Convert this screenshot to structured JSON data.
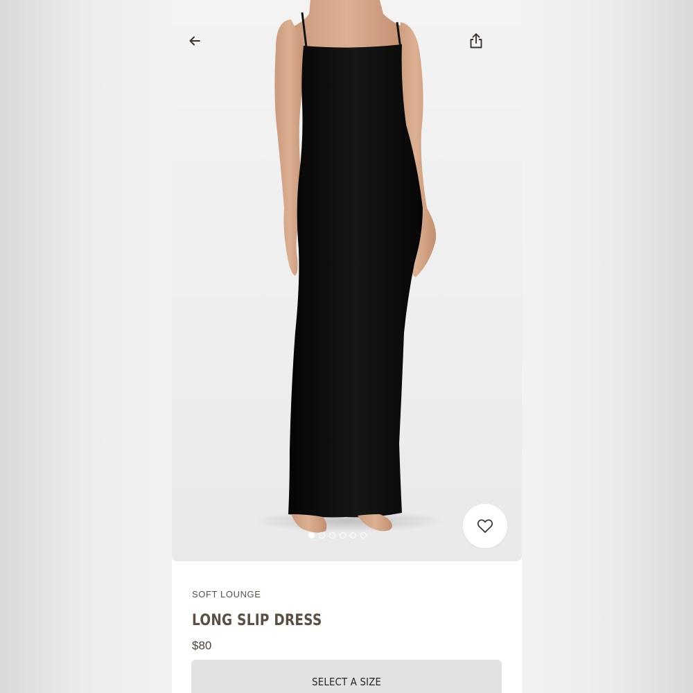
{
  "product": {
    "collection": "SOFT LOUNGE",
    "name": "LONG SLIP DRESS",
    "price": "$80",
    "image_alt": "Model wearing black long slip dress"
  },
  "gallery": {
    "total_images": 6,
    "active_index": 0
  },
  "actions": {
    "select_size_label": "SELECT A SIZE"
  },
  "icons": {
    "back": "arrow-left-icon",
    "share": "share-icon",
    "favorite": "heart-icon"
  },
  "colors": {
    "brand_text": "#5b4e43",
    "button_bg": "#e2e2e4",
    "dress": "#0d0d0d",
    "background": "#f2f2f2"
  }
}
